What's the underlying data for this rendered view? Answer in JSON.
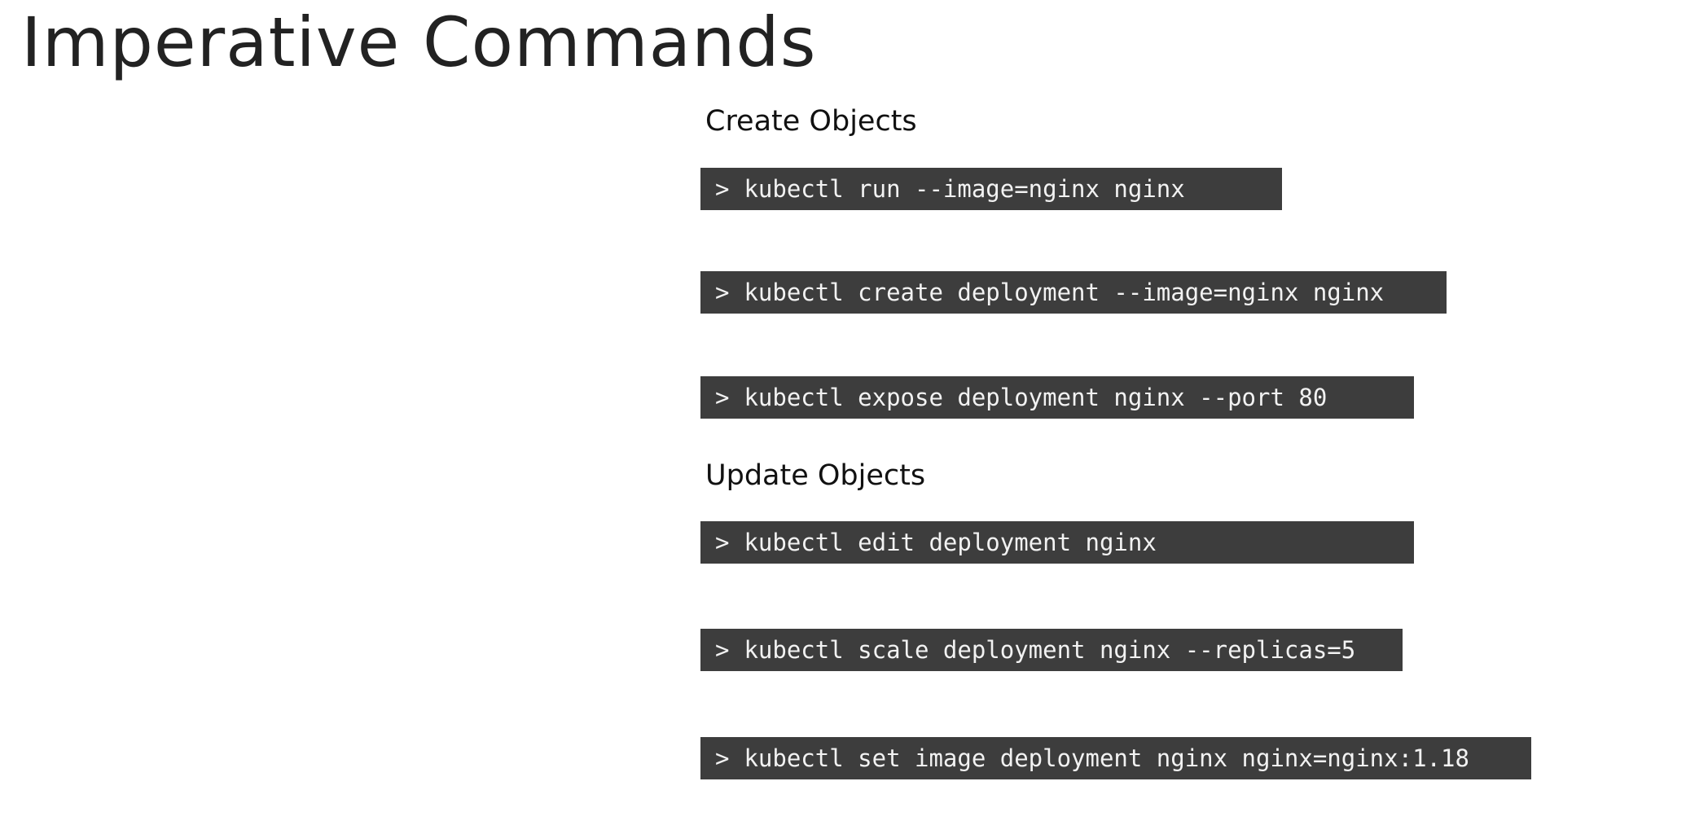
{
  "title": "Imperative  Commands",
  "sections": [
    {
      "heading": "Create Objects",
      "commands": [
        {
          "prompt": ">",
          "text": "kubectl run --image=nginx nginx"
        },
        {
          "prompt": ">",
          "text": "kubectl create deployment --image=nginx nginx"
        },
        {
          "prompt": ">",
          "text": "kubectl expose deployment nginx --port 80"
        }
      ]
    },
    {
      "heading": "Update Objects",
      "commands": [
        {
          "prompt": ">",
          "text": "kubectl edit deployment nginx"
        },
        {
          "prompt": ">",
          "text": "kubectl scale deployment nginx --replicas=5"
        },
        {
          "prompt": ">",
          "text": "kubectl set image deployment nginx nginx=nginx:1.18"
        }
      ]
    }
  ],
  "colors": {
    "command_background": "#3d3d3d",
    "command_text": "#f2f2f2",
    "title_text": "#222222"
  }
}
